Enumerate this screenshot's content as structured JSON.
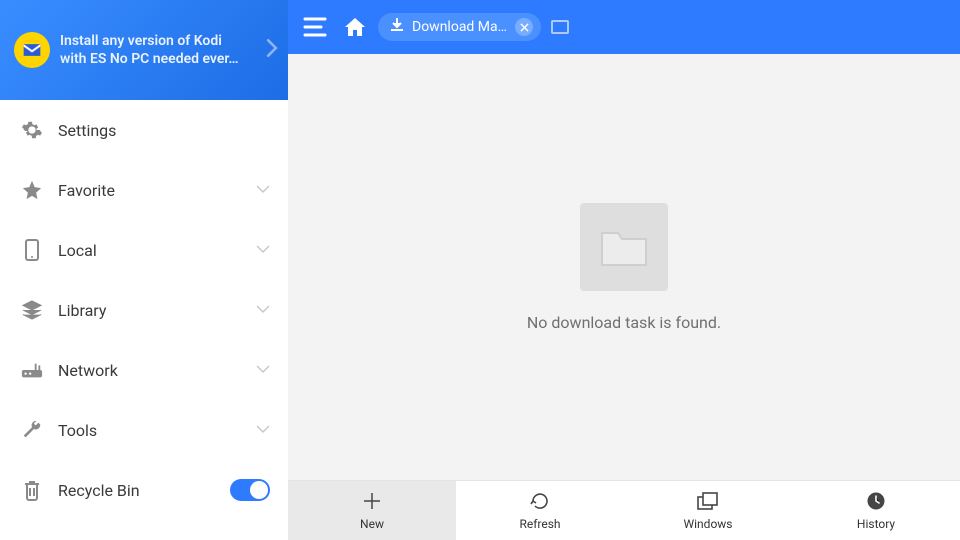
{
  "promo": {
    "text": "Install any version of Kodi with ES No PC needed ever…"
  },
  "sidebar": {
    "items": [
      {
        "label": "Settings",
        "icon": "gear-icon",
        "expandable": false,
        "toggle": false
      },
      {
        "label": "Favorite",
        "icon": "star-icon",
        "expandable": true,
        "toggle": false
      },
      {
        "label": "Local",
        "icon": "phone-icon",
        "expandable": true,
        "toggle": false
      },
      {
        "label": "Library",
        "icon": "layers-icon",
        "expandable": true,
        "toggle": false
      },
      {
        "label": "Network",
        "icon": "router-icon",
        "expandable": true,
        "toggle": false
      },
      {
        "label": "Tools",
        "icon": "wrench-icon",
        "expandable": true,
        "toggle": false
      },
      {
        "label": "Recycle Bin",
        "icon": "trash-icon",
        "expandable": false,
        "toggle": true,
        "toggle_on": true
      }
    ]
  },
  "topbar": {
    "tab_label": "Download Ma…"
  },
  "content": {
    "empty_message": "No download task is found."
  },
  "bottombar": {
    "items": [
      {
        "label": "New",
        "icon": "plus-icon",
        "active": true
      },
      {
        "label": "Refresh",
        "icon": "refresh-icon",
        "active": false
      },
      {
        "label": "Windows",
        "icon": "windows-icon",
        "active": false
      },
      {
        "label": "History",
        "icon": "clock-icon",
        "active": false
      }
    ]
  }
}
